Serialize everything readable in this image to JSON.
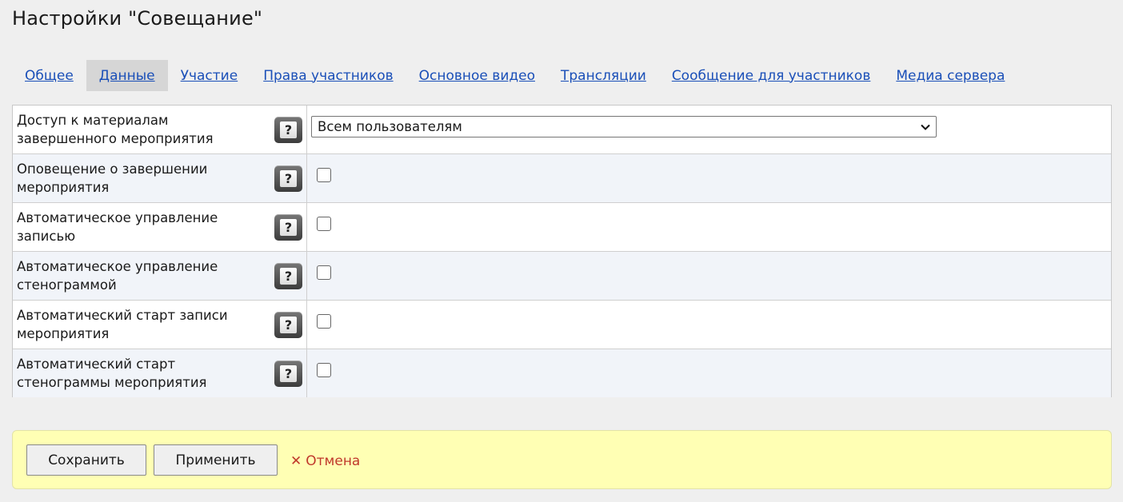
{
  "page": {
    "title": "Настройки \"Совещание\""
  },
  "tabs": [
    {
      "label": "Общее",
      "active": false
    },
    {
      "label": "Данные",
      "active": true
    },
    {
      "label": "Участие",
      "active": false
    },
    {
      "label": "Права участников",
      "active": false
    },
    {
      "label": "Основное видео",
      "active": false
    },
    {
      "label": "Трансляции",
      "active": false
    },
    {
      "label": "Сообщение для участников",
      "active": false
    },
    {
      "label": "Медиа сервера",
      "active": false
    }
  ],
  "settings": [
    {
      "label_line1": "Доступ к материалам",
      "label_line2": "завершенного мероприятия",
      "control": "select",
      "value": "Всем пользователям"
    },
    {
      "label_line1": "Оповещение о завершении",
      "label_line2": "мероприятия",
      "control": "checkbox",
      "checked": false
    },
    {
      "label_line1": "Автоматическое управление",
      "label_line2": "записью",
      "control": "checkbox",
      "checked": false
    },
    {
      "label_line1": "Автоматическое управление",
      "label_line2": "стенограммой",
      "control": "checkbox",
      "checked": false
    },
    {
      "label_line1": "Автоматический старт записи",
      "label_line2": "мероприятия",
      "control": "checkbox",
      "checked": false
    },
    {
      "label_line1": "Автоматический старт",
      "label_line2": "стенограммы мероприятия",
      "control": "checkbox",
      "checked": false
    }
  ],
  "help_icon_glyph": "?",
  "actions": {
    "save_label": "Сохранить",
    "apply_label": "Применить",
    "cancel_glyph": "✕",
    "cancel_label": "Отмена"
  },
  "colors": {
    "link": "#1a4fb8",
    "active_tab_bg": "#d6d6d6",
    "action_bar_bg": "#ffffb4",
    "cancel": "#c0392b"
  }
}
